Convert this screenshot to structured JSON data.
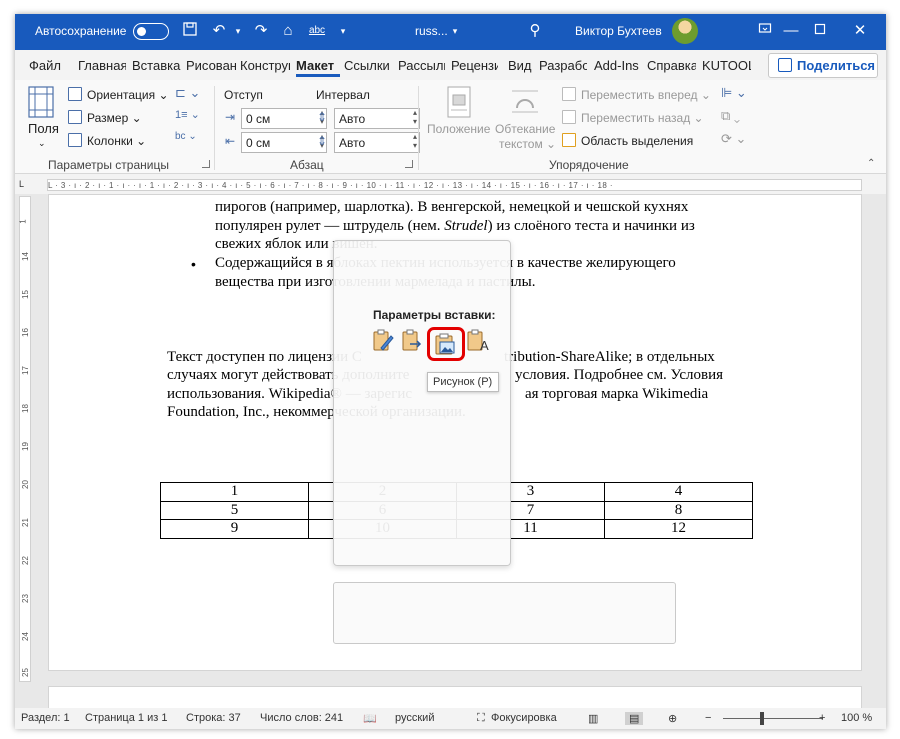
{
  "titlebar": {
    "autosave_label": "Автосохранение",
    "doc_name": "russ...",
    "user_name": "Виктор Бухтеев",
    "window_controls": [
      "minimize",
      "restore",
      "close"
    ]
  },
  "tabs": [
    "Файл",
    "Главная",
    "Вставка",
    "Рисование",
    "Конструктор",
    "Макет",
    "Ссылки",
    "Рассылки",
    "Рецензирование",
    "Вид",
    "Разработчик",
    "Add-Ins",
    "Справка",
    "KUTOOLS"
  ],
  "active_tab": "Макет",
  "share_label": "Поделиться",
  "ribbon": {
    "page_setup": {
      "fields_label": "Поля",
      "orientation": "Ориентация",
      "size": "Размер",
      "columns": "Колонки",
      "group_label": "Параметры страницы"
    },
    "paragraph": {
      "indent_label": "Отступ",
      "spacing_label": "Интервал",
      "indent_left": "0 см",
      "indent_right": "0 см",
      "spacing_before": "Авто",
      "spacing_after": "Авто",
      "group_label": "Абзац"
    },
    "arrange": {
      "position": "Положение",
      "wrap_text_1": "Обтекание",
      "wrap_text_2": "текстом",
      "bring_forward": "Переместить вперед",
      "send_backward": "Переместить назад",
      "selection_pane": "Область выделения",
      "group_label": "Упорядочение"
    }
  },
  "ruler_text": "L  · 3 · ı · 2 · ı · 1 · ı ·  · ı · 1 · ı · 2 · ı · 3 · ı · 4 · ı · 5 · ı · 6 · ı · 7 · ı · 8 · ı · 9 · ı · 10 · ı · 11 · ı · 12 · ı · 13 · ı · 14 · ı · 15 · ı · 16 · ı · 17 · ı · 18 ·",
  "document": {
    "line1": "пирогов (например, шарлотка). В венгерской, немецкой и чешской кухнях",
    "line2_a": "популярен рулет — штрудель (нем. ",
    "line2_italic": "Strudel",
    "line2_b": ") из слоёного теста и начинки из",
    "line3": "свежих яблок или вишен.",
    "bullet2_line1": "Содержащийся в яблоках пектин используется в качестве желирующего",
    "bullet2_line2": "вещества при изготовлении мармелада и пастилы.",
    "para_line1_a": "Текст доступен по лицензии C",
    "para_line1_b": "tribution-ShareAlike; в отдельных",
    "para_line2_a": "случаях могут действовать дополните",
    "para_line2_b": "условия. Подробнее см. Условия",
    "para_line3_a": "использования. Wikipedia® — зарегис",
    "para_line3_b": "ая торговая марка Wikimedia",
    "para_line4": "Foundation, Inc., некоммерческой организации.",
    "table": [
      [
        "1",
        "2",
        "3",
        "4"
      ],
      [
        "5",
        "6",
        "7",
        "8"
      ],
      [
        "9",
        "10",
        "11",
        "12"
      ]
    ]
  },
  "paste_popup": {
    "title": "Параметры вставки:",
    "tooltip": "Рисунок (Р)"
  },
  "statusbar": {
    "section": "Раздел: 1",
    "page": "Страница 1 из 1",
    "line": "Строка: 37",
    "words": "Число слов: 241",
    "language": "русский",
    "focus": "Фокусировка",
    "zoom": "100 %"
  }
}
